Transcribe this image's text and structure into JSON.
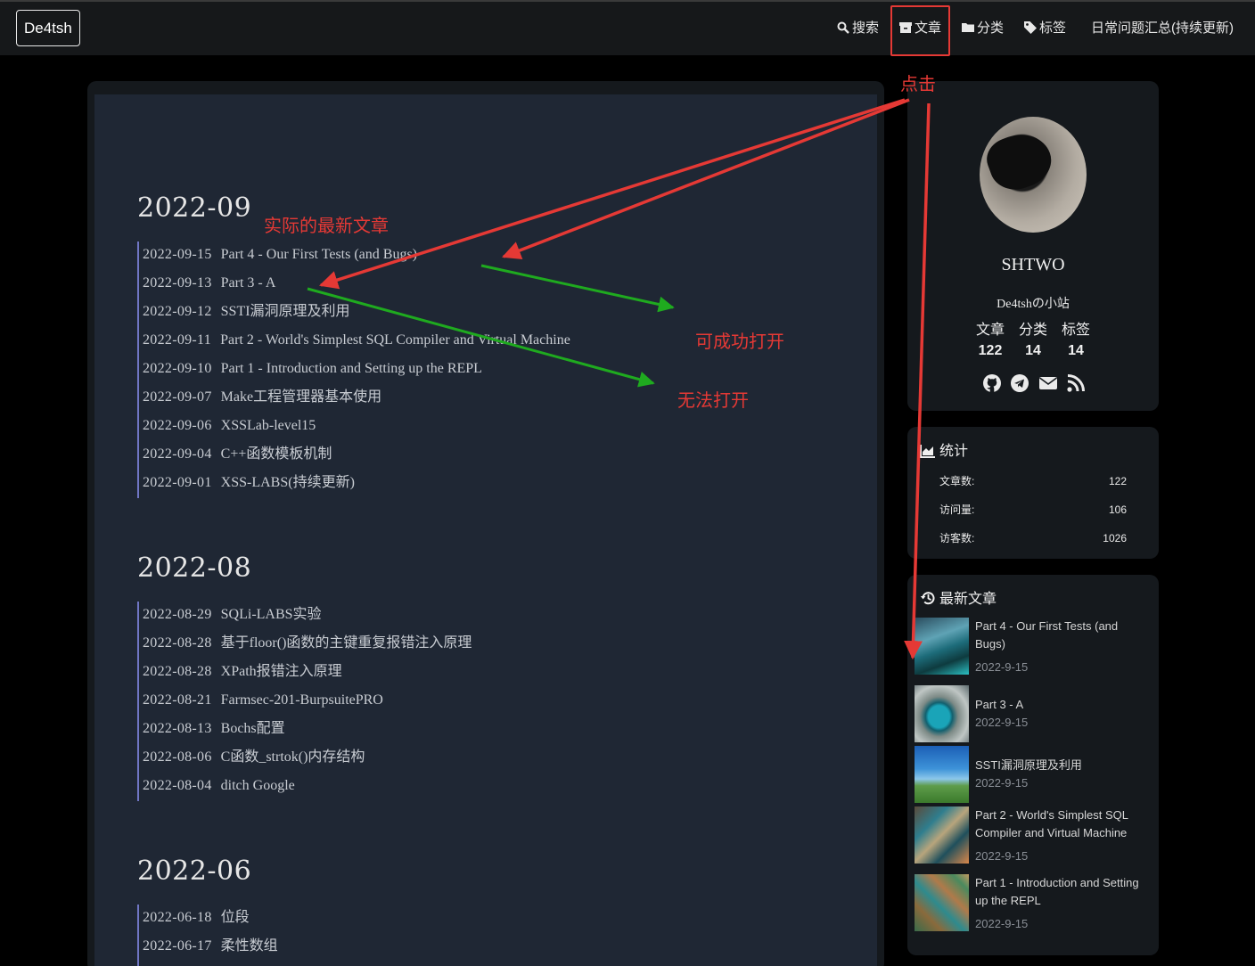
{
  "navbar": {
    "brand": "De4tsh",
    "items": [
      {
        "label": "搜索",
        "icon": "search-icon"
      },
      {
        "label": "文章",
        "icon": "archive-icon"
      },
      {
        "label": "分类",
        "icon": "folder-icon"
      },
      {
        "label": "标签",
        "icon": "tag-icon"
      },
      {
        "label": "日常问题汇总(持续更新)",
        "icon": ""
      }
    ]
  },
  "archive": {
    "groups": [
      {
        "year": "2022-09",
        "posts": [
          {
            "date": "2022-09-15",
            "title": "Part 4 - Our First Tests (and Bugs)"
          },
          {
            "date": "2022-09-13",
            "title": "Part 3 - A"
          },
          {
            "date": "2022-09-12",
            "title": "SSTI漏洞原理及利用"
          },
          {
            "date": "2022-09-11",
            "title": "Part 2 - World's Simplest SQL Compiler and Virtual Machine"
          },
          {
            "date": "2022-09-10",
            "title": "Part 1 - Introduction and Setting up the REPL"
          },
          {
            "date": "2022-09-07",
            "title": "Make工程管理器基本使用"
          },
          {
            "date": "2022-09-06",
            "title": "XSSLab-level15"
          },
          {
            "date": "2022-09-04",
            "title": "C++函数模板机制"
          },
          {
            "date": "2022-09-01",
            "title": "XSS-LABS(持续更新)"
          }
        ]
      },
      {
        "year": "2022-08",
        "posts": [
          {
            "date": "2022-08-29",
            "title": "SQLi-LABS实验"
          },
          {
            "date": "2022-08-28",
            "title": "基于floor()函数的主键重复报错注入原理"
          },
          {
            "date": "2022-08-28",
            "title": "XPath报错注入原理"
          },
          {
            "date": "2022-08-21",
            "title": "Farmsec-201-BurpsuitePRO"
          },
          {
            "date": "2022-08-13",
            "title": "Bochs配置"
          },
          {
            "date": "2022-08-06",
            "title": "C函数_strtok()内存结构"
          },
          {
            "date": "2022-08-04",
            "title": "ditch Google"
          }
        ]
      },
      {
        "year": "2022-06",
        "posts": [
          {
            "date": "2022-06-18",
            "title": "位段"
          },
          {
            "date": "2022-06-17",
            "title": "柔性数组"
          }
        ]
      }
    ]
  },
  "profile": {
    "name": "SHTWO",
    "motto": "De4tshの小站",
    "stats": [
      {
        "label": "文章",
        "value": "122"
      },
      {
        "label": "分类",
        "value": "14"
      },
      {
        "label": "标签",
        "value": "14"
      }
    ],
    "social": [
      "github-icon",
      "telegram-icon",
      "mail-icon",
      "rss-icon"
    ]
  },
  "site_stats": {
    "title": "统计",
    "rows": [
      {
        "label": "文章数:",
        "value": "122"
      },
      {
        "label": "访问量:",
        "value": "106"
      },
      {
        "label": "访客数:",
        "value": "1026"
      }
    ]
  },
  "recent_posts": {
    "title": "最新文章",
    "items": [
      {
        "title": "Part 4 - Our First Tests (and Bugs)",
        "date": "2022-9-15"
      },
      {
        "title": "Part 3 - A",
        "date": "2022-9-15"
      },
      {
        "title": "SSTI漏洞原理及利用",
        "date": "2022-9-15"
      },
      {
        "title": "Part 2 - World's Simplest SQL Compiler and Virtual Machine",
        "date": "2022-9-15"
      },
      {
        "title": "Part 1 - Introduction and Setting up the REPL",
        "date": "2022-9-15"
      }
    ]
  },
  "annotations": {
    "click": "点击",
    "actual_latest": "实际的最新文章",
    "opens_ok": "可成功打开",
    "cannot_open": "无法打开"
  },
  "colors": {
    "annotation_red": "#e53935",
    "annotation_green": "#1faa1f",
    "timeline": "#7076c4"
  }
}
